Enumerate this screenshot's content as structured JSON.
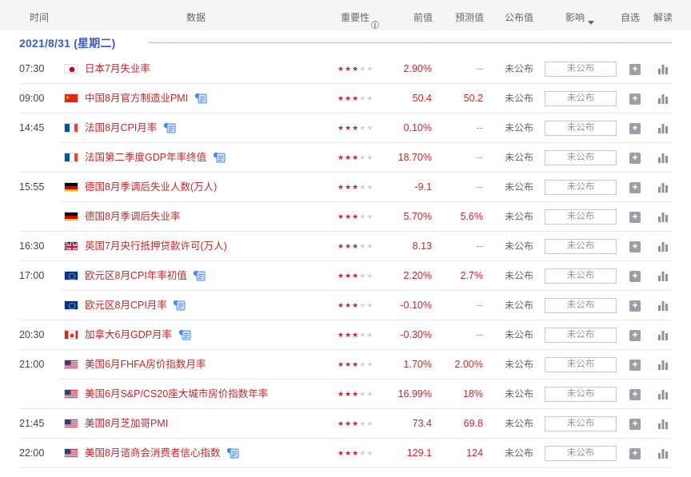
{
  "header": {
    "time": "时间",
    "data": "数据",
    "importance": "重要性",
    "previous": "前值",
    "forecast": "预测值",
    "actual": "公布值",
    "impact": "影响",
    "favorite": "自选",
    "interpret": "解读"
  },
  "date_label": "2021/8/31 (星期二)",
  "colors": {
    "accent_red": "#c0282d",
    "date_blue": "#3a5cc5",
    "star_off": "#d0d0d0"
  },
  "rows": [
    {
      "time": "07:30",
      "flag": "jp",
      "name": "日本7月失业率",
      "report": false,
      "stars": 3,
      "prev": "2.90%",
      "forecast": "--",
      "status": "未公布",
      "impact": "未公布"
    },
    {
      "time": "09:00",
      "flag": "cn",
      "name": "中国8月官方制造业PMI",
      "report": true,
      "stars": 3,
      "prev": "50.4",
      "forecast": "50.2",
      "status": "未公布",
      "impact": "未公布"
    },
    {
      "time": "14:45",
      "flag": "fr",
      "name": "法国8月CPI月率",
      "report": true,
      "stars": 3,
      "prev": "0.10%",
      "forecast": "--",
      "status": "未公布",
      "impact": "未公布"
    },
    {
      "time": "",
      "flag": "fr",
      "name": "法国第二季度GDP年率终值",
      "report": true,
      "stars": 3,
      "prev": "18.70%",
      "forecast": "--",
      "status": "未公布",
      "impact": "未公布"
    },
    {
      "time": "15:55",
      "flag": "de",
      "name": "德国8月季调后失业人数(万人)",
      "report": false,
      "stars": 3,
      "prev": "-9.1",
      "forecast": "--",
      "status": "未公布",
      "impact": "未公布"
    },
    {
      "time": "",
      "flag": "de",
      "name": "德国8月季调后失业率",
      "report": false,
      "stars": 3,
      "prev": "5.70%",
      "forecast": "5.6%",
      "status": "未公布",
      "impact": "未公布"
    },
    {
      "time": "16:30",
      "flag": "gb",
      "name": "英国7月央行抵押贷款许可(万人)",
      "report": false,
      "stars": 3,
      "prev": "8.13",
      "forecast": "--",
      "status": "未公布",
      "impact": "未公布"
    },
    {
      "time": "17:00",
      "flag": "eu",
      "name": "欧元区8月CPI年率初值",
      "report": true,
      "stars": 3,
      "prev": "2.20%",
      "forecast": "2.7%",
      "status": "未公布",
      "impact": "未公布"
    },
    {
      "time": "",
      "flag": "eu",
      "name": "欧元区8月CPI月率",
      "report": true,
      "stars": 3,
      "prev": "-0.10%",
      "forecast": "--",
      "status": "未公布",
      "impact": "未公布"
    },
    {
      "time": "20:30",
      "flag": "ca",
      "name": "加拿大6月GDP月率",
      "report": true,
      "stars": 3,
      "prev": "-0.30%",
      "forecast": "--",
      "status": "未公布",
      "impact": "未公布"
    },
    {
      "time": "21:00",
      "flag": "us",
      "name": "美国6月FHFA房价指数月率",
      "report": false,
      "stars": 3,
      "prev": "1.70%",
      "forecast": "2.00%",
      "status": "未公布",
      "impact": "未公布"
    },
    {
      "time": "",
      "flag": "us",
      "name": "美国6月S&P/CS20座大城市房价指数年率",
      "report": false,
      "stars": 3,
      "prev": "16.99%",
      "forecast": "18%",
      "status": "未公布",
      "impact": "未公布"
    },
    {
      "time": "21:45",
      "flag": "us",
      "name": "美国8月芝加哥PMI",
      "report": false,
      "stars": 3,
      "prev": "73.4",
      "forecast": "69.8",
      "status": "未公布",
      "impact": "未公布"
    },
    {
      "time": "22:00",
      "flag": "us",
      "name": "美国8月谘商会消费者信心指数",
      "report": true,
      "stars": 3,
      "prev": "129.1",
      "forecast": "124",
      "status": "未公布",
      "impact": "未公布"
    }
  ]
}
